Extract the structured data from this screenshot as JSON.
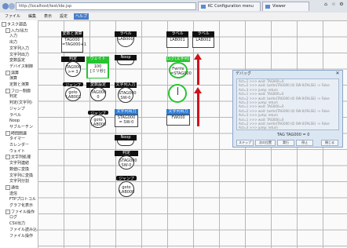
{
  "browser": {
    "url": "http://localhost/test/ide.jsp",
    "tabs": [
      {
        "label": "KC Configuration menu"
      },
      {
        "label": "Viewer"
      }
    ]
  },
  "menubar": {
    "items": [
      "ファイル",
      "編集",
      "表示",
      "設定",
      "ヘルプ"
    ]
  },
  "sidebar": {
    "items": [
      {
        "label": "タスク部品",
        "level": 0,
        "exp": "-"
      },
      {
        "label": "入力/出力",
        "level": 1,
        "exp": "-"
      },
      {
        "label": "入力",
        "level": 2
      },
      {
        "label": "出力",
        "level": 2
      },
      {
        "label": "文字列入力",
        "level": 2
      },
      {
        "label": "文字列出力",
        "level": 2
      },
      {
        "label": "変数設定",
        "level": 2
      },
      {
        "label": "デバイス制御",
        "level": 2
      },
      {
        "label": "演算",
        "level": 1,
        "exp": "-"
      },
      {
        "label": "演算",
        "level": 2
      },
      {
        "label": "定数と演算",
        "level": 2
      },
      {
        "label": "フロー制御",
        "level": 1,
        "exp": "-"
      },
      {
        "label": "判定",
        "level": 2
      },
      {
        "label": "判定(文字列)",
        "level": 2
      },
      {
        "label": "ジャンプ",
        "level": 2
      },
      {
        "label": "ラベル",
        "level": 2
      },
      {
        "label": "Noop",
        "level": 2
      },
      {
        "label": "サブルーチン",
        "level": 2
      },
      {
        "label": "時間関連",
        "level": 1,
        "exp": "-"
      },
      {
        "label": "タイマー",
        "level": 2
      },
      {
        "label": "カレンダー",
        "level": 2
      },
      {
        "label": "ウェイト",
        "level": 2
      },
      {
        "label": "文字列処理",
        "level": 1,
        "exp": "-"
      },
      {
        "label": "文字列連結",
        "level": 2
      },
      {
        "label": "数値に変換",
        "level": 2
      },
      {
        "label": "文字列に変換",
        "level": 2
      },
      {
        "label": "文字列分割",
        "level": 2
      },
      {
        "label": "通信",
        "level": 1,
        "exp": "-"
      },
      {
        "label": "送信",
        "level": 2
      },
      {
        "label": "FTPプロトコル",
        "level": 2
      },
      {
        "label": "グラフ化表示",
        "level": 2
      },
      {
        "label": "ファイル操作",
        "level": 1,
        "exp": "-"
      },
      {
        "label": "ログ",
        "level": 2
      },
      {
        "label": "CSV出力",
        "level": 2
      },
      {
        "label": "ファイル読み込み",
        "level": 2
      },
      {
        "label": "ファイル操作",
        "level": 2
      }
    ]
  },
  "nodes": {
    "a": {
      "title": "変数と演算",
      "body": "TAG000\n=TAG000+1"
    },
    "b": {
      "title": "判定",
      "body": "TAG000\n>= 3"
    },
    "c": {
      "title": "ウェイト",
      "body": "100\n[ミリ秒]"
    },
    "d": {
      "title": "ジャンプ",
      "body": "goto\nLAB001"
    },
    "e": {
      "title": "変数設定",
      "body": "TAG000\n0"
    },
    "f": {
      "title": "ジャンプ",
      "body": "goto\nLAB000"
    },
    "g": {
      "title": "ラベル",
      "body": "LAB000"
    },
    "h": {
      "title": "Noop",
      "body": ""
    },
    "i": {
      "title": "文字列入力",
      "body": "STAG000\nSW-0"
    },
    "j": {
      "title": "文字列出力",
      "body": "STAG000\n= SW-0"
    },
    "k": {
      "title": "Noop",
      "body": ""
    },
    "l": {
      "title": "判定",
      "body": "STAG000\nSW-0"
    },
    "m": {
      "title": "ジャンプ",
      "body": "goto\nLAB000"
    },
    "n": {
      "title": "ラベル",
      "body": "LAB001"
    },
    "o": {
      "title": "ログ(文字列)",
      "body": "Fwrite\n=STAG000"
    },
    "p": {
      "title": "文字列出力",
      "body": "FW000"
    },
    "q": {
      "title": "ラベル",
      "body": "LAB002"
    }
  },
  "dialog": {
    "title": "デバッグ",
    "log": [
      "Act=1 >>> wait: TAG000=0",
      "Act=2 >>> wait: (write)TAG000 (0) SW-0(FALSE) -> False",
      "Act=3 >>> jump: return",
      "Act=1 >>> wait: TAG000=0",
      "Act=2 >>> wait: (write)TAG000 (0) SW-0(FALSE) -> False",
      "Act=3 >>> jump: return",
      "Act=1 >>> wait: TAG000=0",
      "Act=2 >>> wait: (write)TAG000 (0) SW-0(FALSE) -> False",
      "Act=3 >>> jump: return",
      "Act=1 >>> wait: TAG000=0",
      "Act=2 >>> wait: (write)TAG000 (0) SW-0(FALSE) -> False",
      "Act=3 >>> jump: return"
    ],
    "variable_line": "TAG      TAG000     = 0",
    "buttons": [
      "ステップ",
      "次の位置",
      "実行",
      "停止",
      "閉じる"
    ]
  },
  "colors": {
    "accent": "#27c431",
    "arrow": "#d0121c",
    "nodehead": "#111111"
  }
}
